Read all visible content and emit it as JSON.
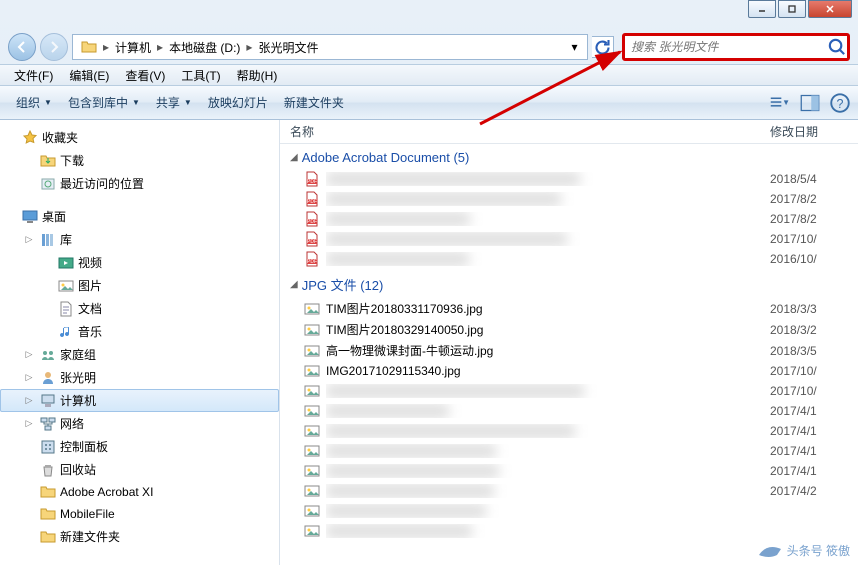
{
  "titlebar": {
    "min": "min",
    "max": "max",
    "close": "close"
  },
  "nav": {
    "crumbs": [
      "计算机",
      "本地磁盘 (D:)",
      "张光明文件"
    ]
  },
  "search": {
    "placeholder": "搜索 张光明文件"
  },
  "menubar": [
    "文件(F)",
    "编辑(E)",
    "查看(V)",
    "工具(T)",
    "帮助(H)"
  ],
  "toolbar": {
    "organize": "组织",
    "include": "包含到库中",
    "share": "共享",
    "slideshow": "放映幻灯片",
    "newfolder": "新建文件夹"
  },
  "columns": {
    "name": "名称",
    "date": "修改日期"
  },
  "sidebar": [
    {
      "depth": 0,
      "exp": "",
      "icon": "star",
      "label": "收藏夹"
    },
    {
      "depth": 1,
      "exp": "",
      "icon": "download",
      "label": "下载"
    },
    {
      "depth": 1,
      "exp": "",
      "icon": "recent",
      "label": "最近访问的位置"
    },
    {
      "gap": true
    },
    {
      "depth": 0,
      "exp": "",
      "icon": "desktop",
      "label": "桌面"
    },
    {
      "depth": 1,
      "exp": "▷",
      "icon": "library",
      "label": "库"
    },
    {
      "depth": 2,
      "exp": "",
      "icon": "video",
      "label": "视频"
    },
    {
      "depth": 2,
      "exp": "",
      "icon": "picture",
      "label": "图片"
    },
    {
      "depth": 2,
      "exp": "",
      "icon": "document",
      "label": "文档"
    },
    {
      "depth": 2,
      "exp": "",
      "icon": "music",
      "label": "音乐"
    },
    {
      "depth": 1,
      "exp": "▷",
      "icon": "homegroup",
      "label": "家庭组"
    },
    {
      "depth": 1,
      "exp": "▷",
      "icon": "user",
      "label": "张光明"
    },
    {
      "depth": 1,
      "exp": "▷",
      "icon": "computer",
      "label": "计算机",
      "selected": true
    },
    {
      "depth": 1,
      "exp": "▷",
      "icon": "network",
      "label": "网络"
    },
    {
      "depth": 1,
      "exp": "",
      "icon": "control",
      "label": "控制面板"
    },
    {
      "depth": 1,
      "exp": "",
      "icon": "recycle",
      "label": "回收站"
    },
    {
      "depth": 1,
      "exp": "",
      "icon": "folder",
      "label": "Adobe Acrobat XI"
    },
    {
      "depth": 1,
      "exp": "",
      "icon": "folder",
      "label": "MobileFile"
    },
    {
      "depth": 1,
      "exp": "",
      "icon": "folder",
      "label": "新建文件夹"
    }
  ],
  "groups": [
    {
      "title": "Adobe Acrobat Document (5)",
      "type": "pdf",
      "rows": [
        {
          "blur": true,
          "date": "2018/5/4"
        },
        {
          "blur": true,
          "date": "2017/8/2"
        },
        {
          "blur": true,
          "date": "2017/8/2"
        },
        {
          "blur": true,
          "date": "2017/10/"
        },
        {
          "blur": true,
          "date": "2016/10/"
        }
      ]
    },
    {
      "title": "JPG 文件 (12)",
      "type": "jpg",
      "rows": [
        {
          "name": "TIM图片20180331170936.jpg",
          "date": "2018/3/3"
        },
        {
          "name": "TIM图片20180329140050.jpg",
          "date": "2018/3/2"
        },
        {
          "name": "高一物理微课封面-牛顿运动.jpg",
          "date": "2018/3/5"
        },
        {
          "name": "IMG20171029115340.jpg",
          "date": "2017/10/"
        },
        {
          "blur": true,
          "date": "2017/10/"
        },
        {
          "blur": true,
          "date": "2017/4/1"
        },
        {
          "blur": true,
          "date": "2017/4/1"
        },
        {
          "blur": true,
          "date": "2017/4/1"
        },
        {
          "blur": true,
          "date": "2017/4/1"
        },
        {
          "blur": true,
          "date": "2017/4/2"
        },
        {
          "blur": true,
          "date": ""
        },
        {
          "blur": true,
          "date": ""
        }
      ]
    }
  ],
  "watermark": "头条号 筱傲"
}
